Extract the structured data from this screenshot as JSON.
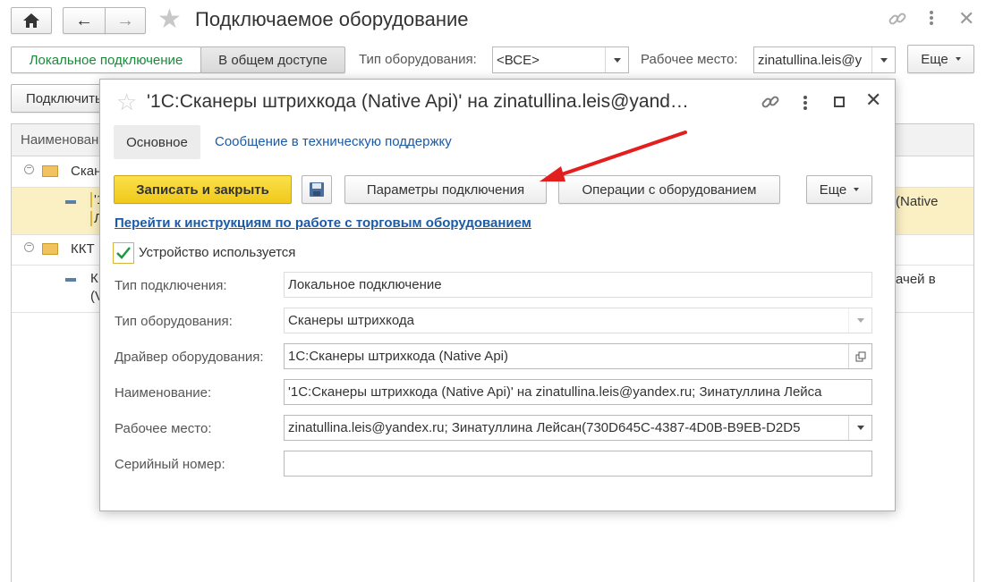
{
  "window": {
    "title": "Подключаемое оборудование"
  },
  "filters": {
    "local_tab": "Локальное подключение",
    "shared_tab": "В общем доступе",
    "eq_type_label": "Тип оборудования:",
    "eq_type_value": "<ВСЕ>",
    "workplace_label": "Рабочее место:",
    "workplace_value": "zinatullina.leis@y",
    "more": "Еще"
  },
  "toolbar": {
    "connect_btn": "Подключить"
  },
  "grid": {
    "header": "Наименование",
    "group1": "Сканеры штрихкода",
    "row1_a": "'1",
    "row1_b": "Л",
    "row1_right": "(Native",
    "group2": "ККТ",
    "row2_a": "К",
    "row2_b": "(V",
    "row2_right": "ачей в"
  },
  "modal": {
    "title": "'1С:Сканеры штрихкода (Native Api)' на zinatullina.leis@yand…",
    "tab_main": "Основное",
    "tab_support": "Сообщение в техническую поддержку",
    "save_close": "Записать и закрыть",
    "conn_params": "Параметры подключения",
    "operations": "Операции с оборудованием",
    "more": "Еще",
    "instructions_link": "Перейти к инструкциям по работе с торговым оборудованием",
    "device_used_label": "Устройство используется",
    "fields": {
      "conn_type_label": "Тип подключения:",
      "conn_type_value": "Локальное подключение",
      "eq_type_label": "Тип оборудования:",
      "eq_type_value": "Сканеры штрихкода",
      "driver_label": "Драйвер оборудования:",
      "driver_value": "1С:Сканеры штрихкода (Native Api)",
      "name_label": "Наименование:",
      "name_value": "'1С:Сканеры штрихкода (Native Api)' на zinatullina.leis@yandex.ru; Зинатуллина Лейса",
      "workplace_label": "Рабочее место:",
      "workplace_value": "zinatullina.leis@yandex.ru; Зинатуллина Лейсан(730D645C-4387-4D0B-B9EB-D2D5",
      "serial_label": "Серийный номер:",
      "serial_value": ""
    }
  },
  "colors": {
    "accent_yellow": "#f5d520",
    "link_blue": "#1b5aa6",
    "arrow_red": "#e31e1e",
    "selected_row": "#fbf0c4"
  }
}
